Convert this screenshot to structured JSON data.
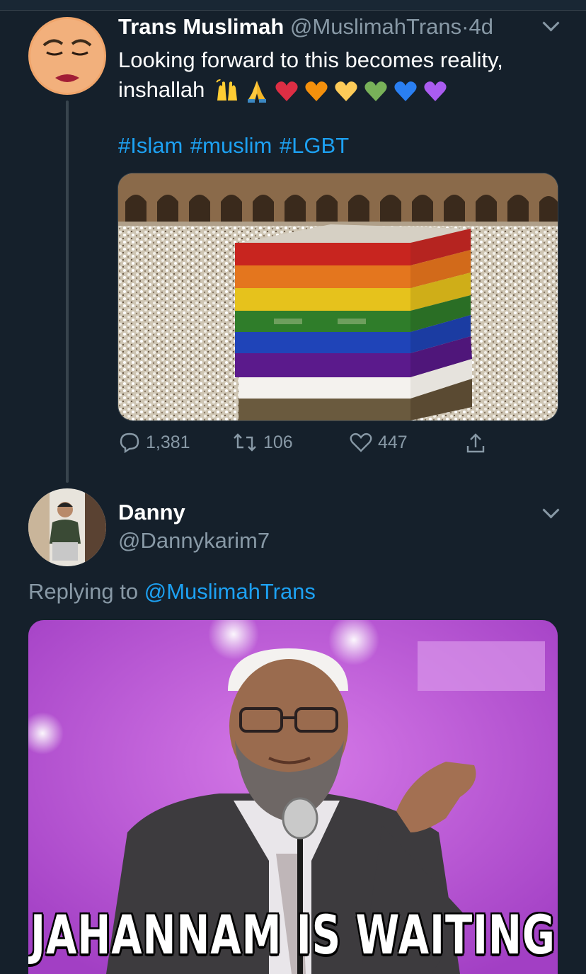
{
  "tweet": {
    "author_name": "Trans Muslimah",
    "author_handle": "@MuslimahTrans",
    "time_sep": "·",
    "time": "4d",
    "text_line1": "Looking forward to this becomes reality,",
    "text_line2": "inshallah",
    "emojis": [
      "raising-hands-icon",
      "folded-hands-icon",
      "red-heart-icon",
      "orange-heart-icon",
      "yellow-heart-icon",
      "green-heart-icon",
      "blue-heart-icon",
      "purple-heart-icon"
    ],
    "hashtags": "#Islam #muslim #LGBT",
    "stats": {
      "replies": "1,381",
      "retweets": "106",
      "likes": "447"
    }
  },
  "reply": {
    "author_name": "Danny",
    "author_handle": "@Dannykarim7",
    "replying_prefix": "Replying to",
    "replying_to": "@MuslimahTrans",
    "meme_caption": "JAHANNAM IS WAITING"
  },
  "colors": {
    "background": "#15202b",
    "accent": "#1da1f2",
    "muted": "#8899a6",
    "divider": "#38444d"
  }
}
